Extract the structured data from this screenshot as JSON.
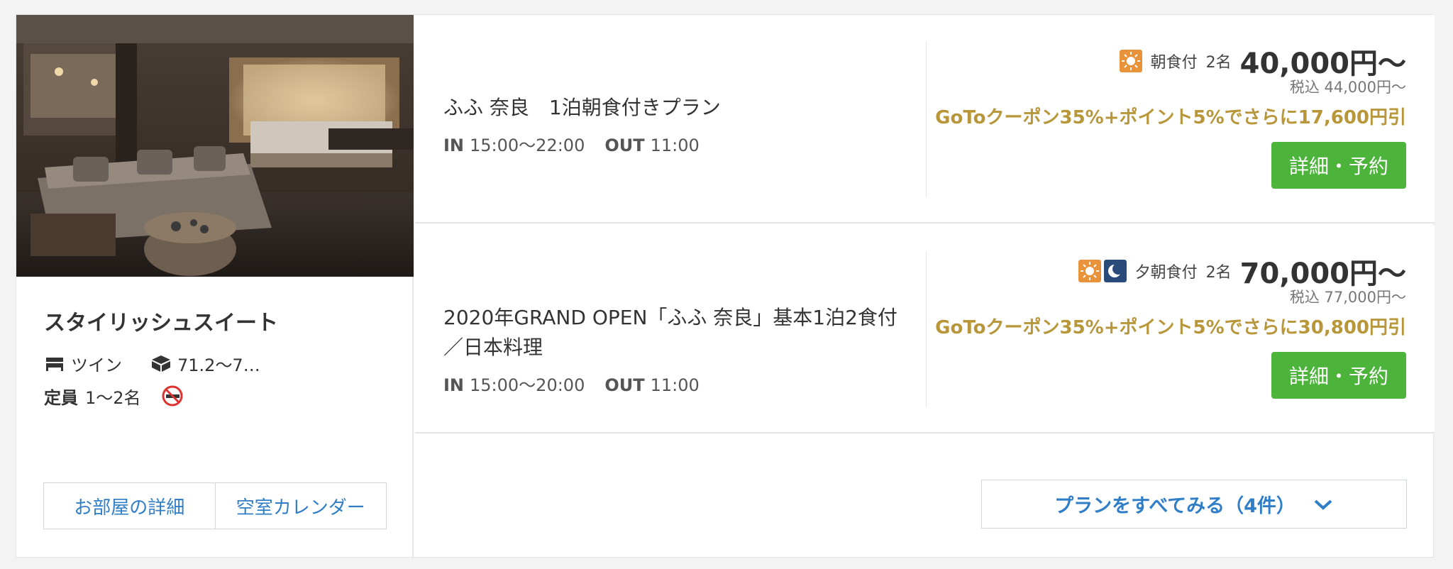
{
  "room": {
    "name": "スタイリッシュスイート",
    "bed_type": "ツイン",
    "size": "71.2〜7…",
    "capacity_label": "定員",
    "capacity_value": "1〜2名",
    "detail_button": "お部屋の詳細",
    "calendar_button": "空室カレンダー"
  },
  "plans": [
    {
      "name": "ふふ 奈良　1泊朝食付きプラン",
      "in_label": "IN",
      "in_time": "15:00〜22:00",
      "out_label": "OUT",
      "out_time": "11:00",
      "meal": "朝食付",
      "persons": "2名",
      "price": "40,000円〜",
      "tax": "税込  44,000円〜",
      "coupon": "GoToクーポン35%+ポイント5%でさらに17,600円引",
      "book_button": "詳細・予約"
    },
    {
      "name": "2020年GRAND OPEN「ふふ 奈良」基本1泊2食付／日本料理",
      "in_label": "IN",
      "in_time": "15:00〜20:00",
      "out_label": "OUT",
      "out_time": "11:00",
      "meal": "夕朝食付",
      "persons": "2名",
      "price": "70,000円〜",
      "tax": "税込  77,000円〜",
      "coupon": "GoToクーポン35%+ポイント5%でさらに30,800円引",
      "book_button": "詳細・予約"
    }
  ],
  "more_plans_button": "プランをすべてみる（4件）",
  "colors": {
    "link": "#2f7ec7",
    "book_button": "#4cb33b",
    "coupon": "#b8963a",
    "breakfast_icon": "#e8923a",
    "dinner_icon": "#2a4a7a"
  },
  "icons": [
    "bed-icon",
    "room-size-icon",
    "no-smoking-icon",
    "breakfast-sun-icon",
    "dinner-moon-icon",
    "chevron-down-icon"
  ]
}
